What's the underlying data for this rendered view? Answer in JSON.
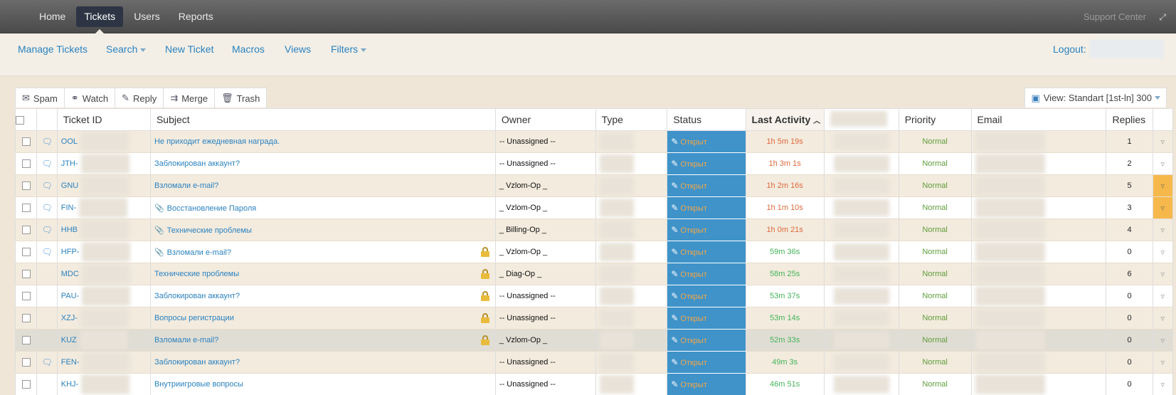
{
  "topnav": {
    "items": [
      "Home",
      "Tickets",
      "Users",
      "Reports"
    ],
    "active": 1,
    "support": "Support Center"
  },
  "subnav": {
    "manage": "Manage Tickets",
    "search": "Search",
    "new_ticket": "New Ticket",
    "macros": "Macros",
    "views": "Views",
    "filters": "Filters",
    "logout": "Logout:"
  },
  "toolbar": {
    "spam": "Spam",
    "watch": "Watch",
    "reply": "Reply",
    "merge": "Merge",
    "trash": "Trash",
    "view": "View: Standart [1st-ln] 300"
  },
  "columns": {
    "ticket_id": "Ticket ID",
    "subject": "Subject",
    "owner": "Owner",
    "type": "Type",
    "status": "Status",
    "last_activity": "Last Activity",
    "priority": "Priority",
    "email": "Email",
    "replies": "Replies"
  },
  "rows": [
    {
      "chat": true,
      "id": "OOL",
      "subject": "Не приходит ежедневная награда.",
      "clip": false,
      "lock": false,
      "owner": "-- Unassigned --",
      "status": "Открыт",
      "activity": "1h 5m 19s",
      "act_color": "orange",
      "priority": "Normal",
      "replies": "1",
      "flag": false
    },
    {
      "chat": true,
      "id": "JTH-",
      "subject": "Заблокирован аккаунт?",
      "clip": false,
      "lock": false,
      "owner": "-- Unassigned --",
      "status": "Открыт",
      "activity": "1h 3m 1s",
      "act_color": "orange",
      "priority": "Normal",
      "replies": "2",
      "flag": false
    },
    {
      "chat": true,
      "id": "GNU",
      "subject": "Взломали e-mail?",
      "clip": false,
      "lock": false,
      "owner": "_ Vzlom-Op _",
      "status": "Открыт",
      "activity": "1h 2m 16s",
      "act_color": "orange",
      "priority": "Normal",
      "replies": "5",
      "flag": true
    },
    {
      "chat": true,
      "id": "FIN-",
      "subject": "Восстановление Пароля",
      "clip": true,
      "lock": false,
      "owner": "_ Vzlom-Op _",
      "status": "Открыт",
      "activity": "1h 1m 10s",
      "act_color": "orange",
      "priority": "Normal",
      "replies": "3",
      "flag": true
    },
    {
      "chat": true,
      "id": "HHB",
      "subject": "Технические проблемы",
      "clip": true,
      "lock": false,
      "owner": "_ Billing-Op _",
      "status": "Открыт",
      "activity": "1h 0m 21s",
      "act_color": "orange",
      "priority": "Normal",
      "replies": "4",
      "flag": false
    },
    {
      "chat": true,
      "id": "HFP-",
      "subject": "Взломали e-mail?",
      "clip": true,
      "lock": true,
      "owner": "_ Vzlom-Op _",
      "status": "Открыт",
      "activity": "59m 36s",
      "act_color": "green",
      "priority": "Normal",
      "replies": "0",
      "flag": false
    },
    {
      "chat": false,
      "id": "MDC",
      "subject": "Технические проблемы",
      "clip": false,
      "lock": true,
      "owner": "_ Diag-Op _",
      "status": "Открыт",
      "activity": "58m 25s",
      "act_color": "green",
      "priority": "Normal",
      "replies": "6",
      "flag": false
    },
    {
      "chat": false,
      "id": "PAU-",
      "subject": "Заблокирован аккаунт?",
      "clip": false,
      "lock": true,
      "owner": "-- Unassigned --",
      "status": "Открыт",
      "activity": "53m 37s",
      "act_color": "green",
      "priority": "Normal",
      "replies": "0",
      "flag": false
    },
    {
      "chat": false,
      "id": "XZJ-",
      "subject": "Вопросы регистрации",
      "clip": false,
      "lock": true,
      "owner": "-- Unassigned --",
      "status": "Открыт",
      "activity": "53m 14s",
      "act_color": "green",
      "priority": "Normal",
      "replies": "0",
      "flag": false
    },
    {
      "chat": false,
      "id": "KUZ",
      "subject": "Взломали e-mail?",
      "clip": false,
      "lock": true,
      "owner": "_ Vzlom-Op _",
      "status": "Открыт",
      "activity": "52m 33s",
      "act_color": "green",
      "priority": "Normal",
      "replies": "0",
      "flag": false
    },
    {
      "chat": true,
      "id": "FEN-",
      "subject": "Заблокирован аккаунт?",
      "clip": false,
      "lock": false,
      "owner": "-- Unassigned --",
      "status": "Открыт",
      "activity": "49m 3s",
      "act_color": "green",
      "priority": "Normal",
      "replies": "0",
      "flag": false
    },
    {
      "chat": false,
      "id": "KHJ-",
      "subject": "Внутриигровые вопросы",
      "clip": false,
      "lock": false,
      "owner": "-- Unassigned --",
      "status": "Открыт",
      "activity": "46m 51s",
      "act_color": "green",
      "priority": "Normal",
      "replies": "0",
      "flag": false
    }
  ],
  "icons": {
    "chat": "speech-bubble-icon",
    "lock": "padlock-icon",
    "clip": "paperclip-icon",
    "status": "ticket-tag-icon",
    "flag": "flag-filter-icon"
  },
  "colors": {
    "status_bg": "#3f93c9",
    "status_text": "#f0a64b",
    "activity_old": "#e06a3c",
    "activity_recent": "#44b45a",
    "flag_on": "#f7b84b"
  }
}
